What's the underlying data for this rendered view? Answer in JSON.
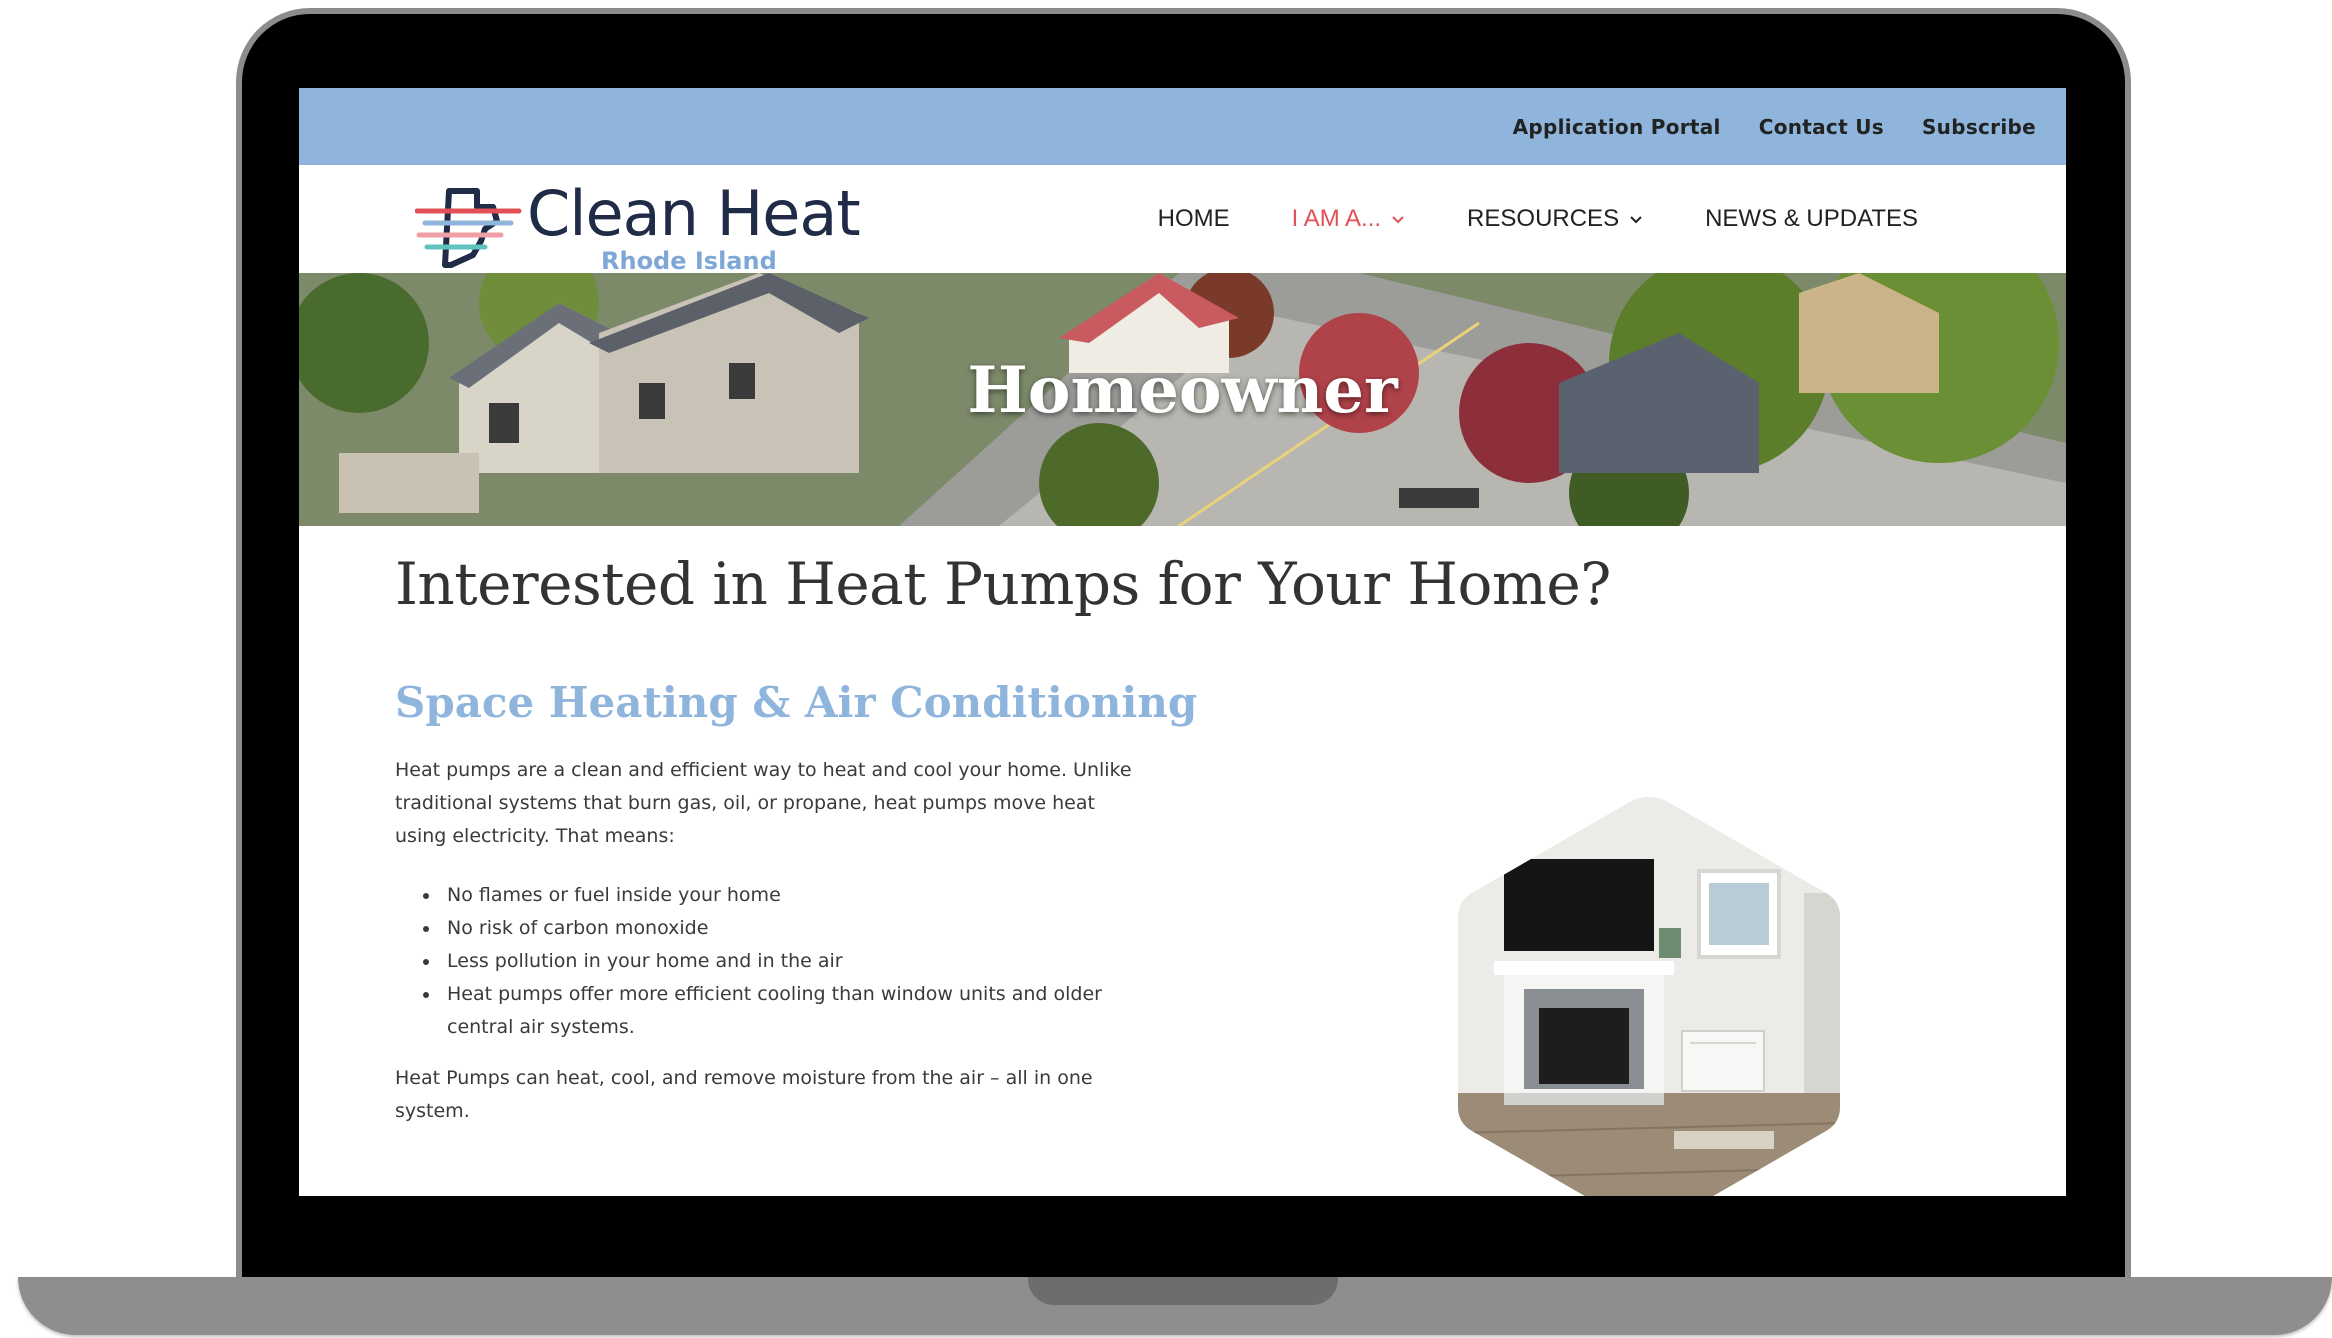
{
  "topbar": {
    "links": [
      {
        "label": "Application Portal"
      },
      {
        "label": "Contact Us"
      },
      {
        "label": "Subscribe"
      }
    ]
  },
  "brand": {
    "title": "Clean Heat",
    "subtitle": "Rhode Island"
  },
  "nav": {
    "items": [
      {
        "label": "HOME",
        "has_dropdown": false,
        "active": false
      },
      {
        "label": "I AM A...",
        "has_dropdown": true,
        "active": true
      },
      {
        "label": "RESOURCES",
        "has_dropdown": true,
        "active": false
      },
      {
        "label": "NEWS & UPDATES",
        "has_dropdown": false,
        "active": false
      }
    ]
  },
  "hero": {
    "title": "Homeowner"
  },
  "main": {
    "title": "Interested in Heat Pumps for Your Home?",
    "section_title": "Space Heating & Air Conditioning",
    "intro": "Heat pumps are a clean and efficient way to heat and cool your home. Unlike traditional systems that burn gas, oil, or propane, heat pumps move heat using electricity. That means:",
    "bullets": [
      "No flames or fuel inside your home",
      "No risk of carbon monoxide",
      "Less pollution in your home and in the air",
      "Heat pumps offer more efficient cooling than window units and older central air systems."
    ],
    "closing": "Heat Pumps can heat, cool, and remove moisture from the air – all in one system."
  },
  "colors": {
    "topbar_bg": "#8fb5dc",
    "accent_blue": "#8fb5dc",
    "nav_active": "#e05055",
    "brand_navy": "#1f2b47"
  },
  "icons": [
    "chevron-down-icon",
    "rhode-island-logo-icon"
  ]
}
